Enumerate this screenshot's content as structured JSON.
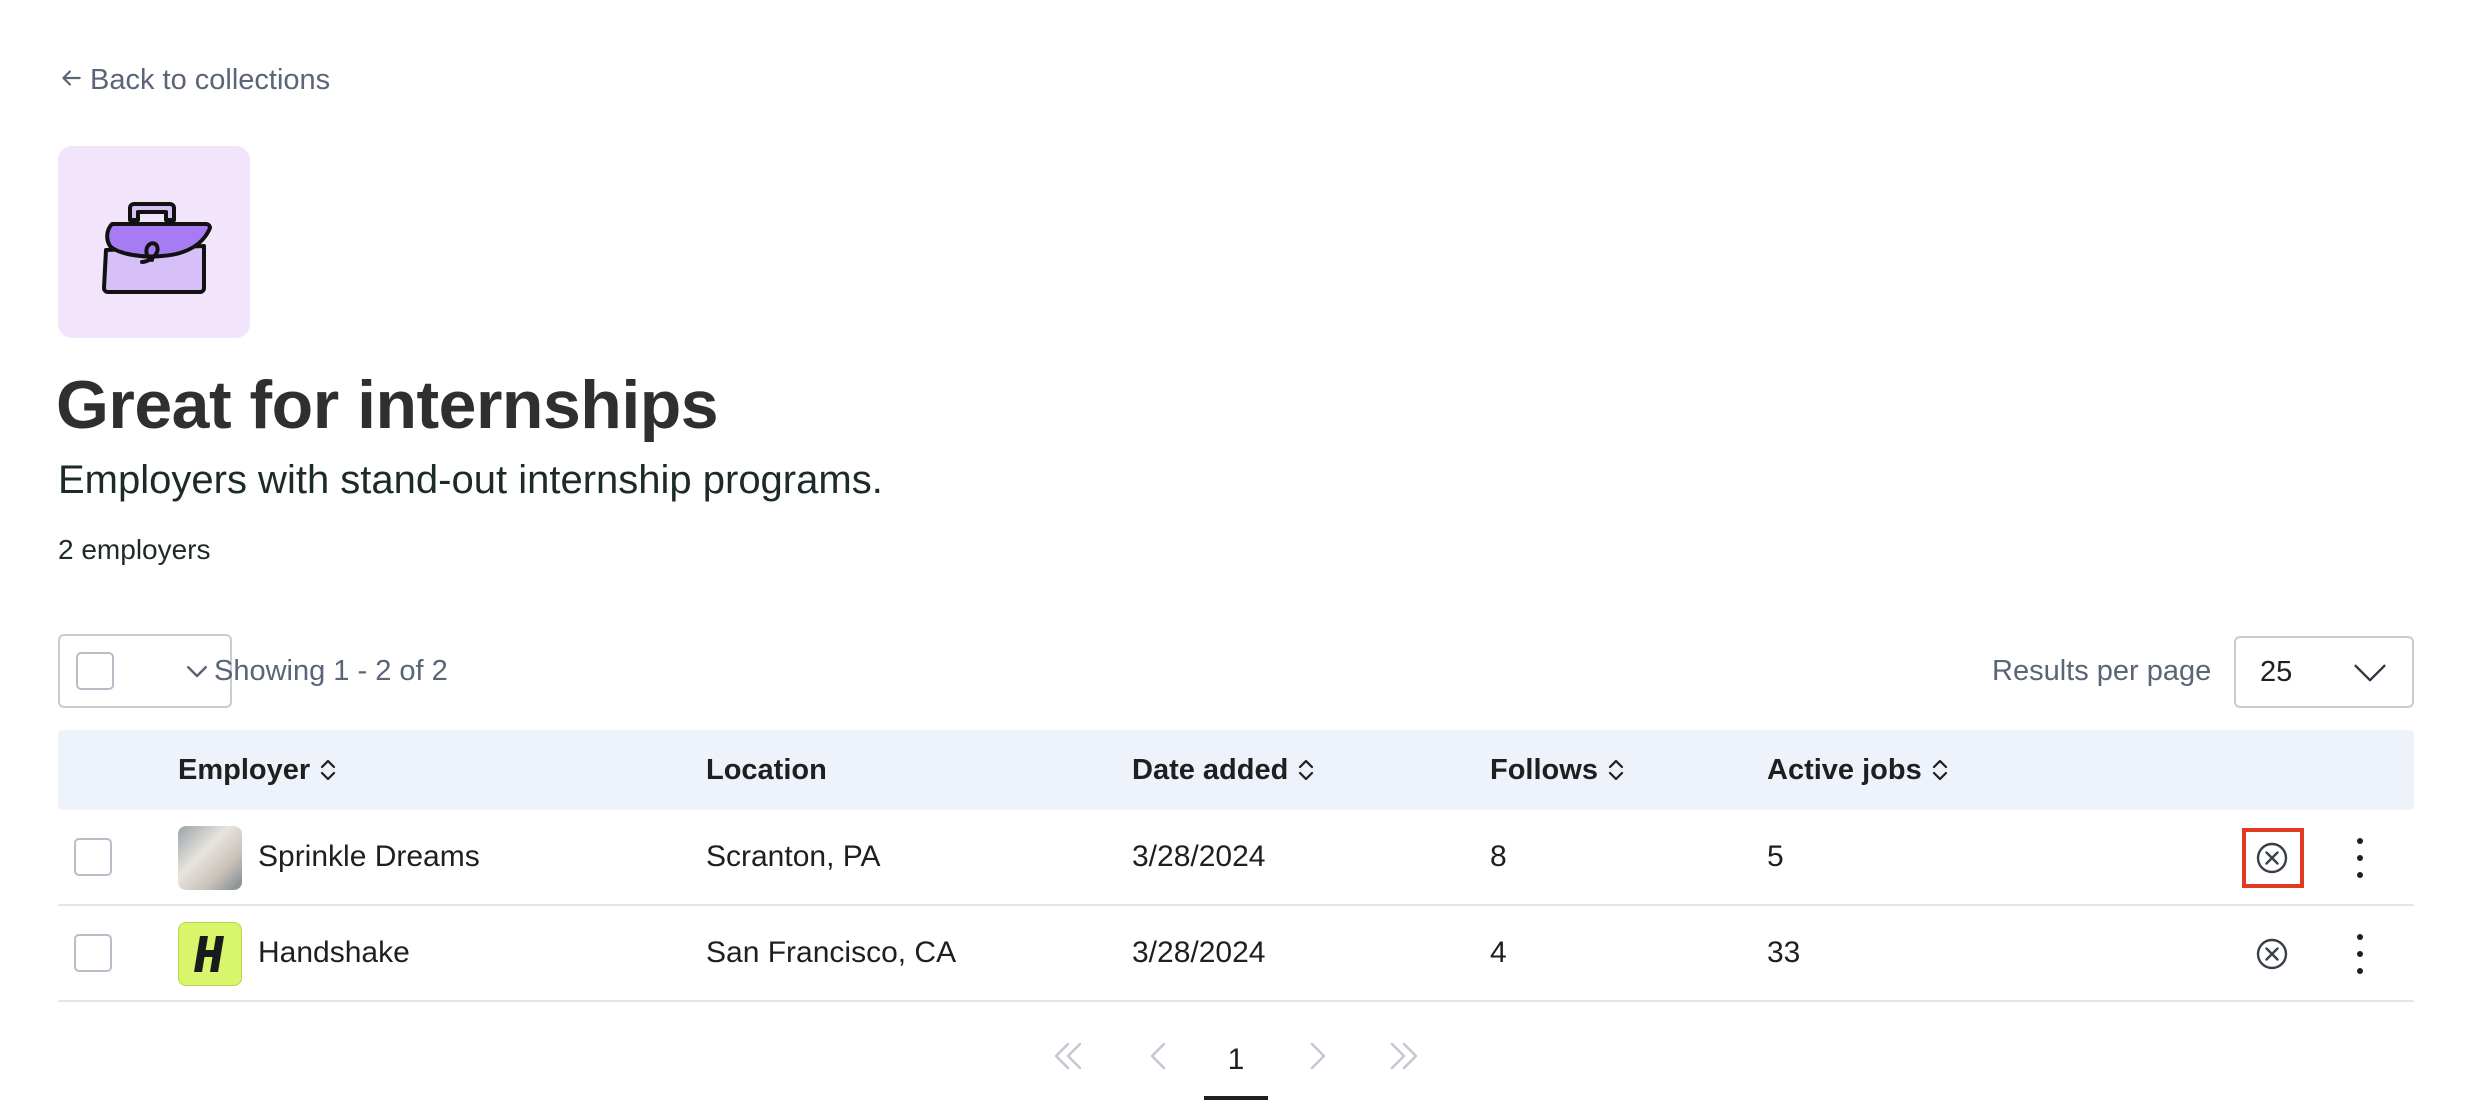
{
  "nav": {
    "back_label": "Back to collections"
  },
  "collection": {
    "icon": "briefcase-icon",
    "title": "Great for internships",
    "description": "Employers with stand-out internship programs.",
    "count_label": "2 employers"
  },
  "toolbar": {
    "showing_label": "Showing 1 - 2 of 2",
    "results_per_page_label": "Results per page",
    "results_per_page_value": "25"
  },
  "table": {
    "columns": [
      {
        "label": "Employer",
        "sortable": true
      },
      {
        "label": "Location",
        "sortable": false
      },
      {
        "label": "Date added",
        "sortable": true
      },
      {
        "label": "Follows",
        "sortable": true
      },
      {
        "label": "Active jobs",
        "sortable": true
      }
    ],
    "rows": [
      {
        "employer": "Sprinkle Dreams",
        "location": "Scranton, PA",
        "date_added": "3/28/2024",
        "follows": "8",
        "active_jobs": "5",
        "highlighted_remove": true
      },
      {
        "employer": "Handshake",
        "location": "San Francisco, CA",
        "date_added": "3/28/2024",
        "follows": "4",
        "active_jobs": "33",
        "highlighted_remove": false
      }
    ]
  },
  "pagination": {
    "current_page": "1"
  },
  "colors": {
    "accent_purple": "#a77bf3",
    "icon_bg": "#f1e4fb",
    "header_bg": "#eef2fa",
    "highlight": "#e03a22",
    "handshake_lime": "#d8f56b"
  }
}
